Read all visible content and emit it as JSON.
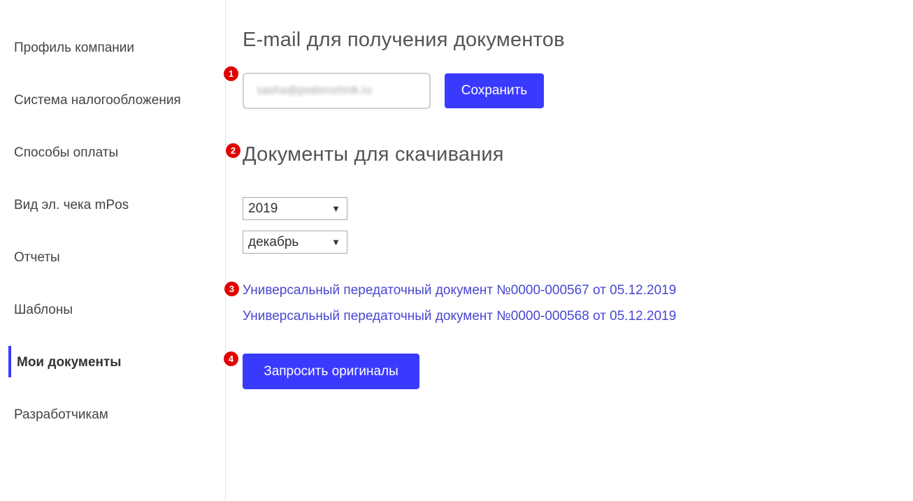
{
  "sidebar": {
    "items": [
      {
        "label": "Профиль компании"
      },
      {
        "label": "Система налогообложения"
      },
      {
        "label": "Способы оплаты"
      },
      {
        "label": "Вид эл. чека mPos"
      },
      {
        "label": "Отчеты"
      },
      {
        "label": "Шаблоны"
      },
      {
        "label": "Мои документы",
        "active": true
      },
      {
        "label": "Разработчикам"
      }
    ],
    "accent_color": "#3e3aff"
  },
  "email_section": {
    "title": "E-mail для получения документов",
    "email_value": "sasha@podorozhnik.ru",
    "save_label": "Сохранить"
  },
  "documents_section": {
    "title": "Документы для скачивания",
    "year_value": "2019",
    "month_value": "декабрь",
    "documents": [
      {
        "label": "Универсальный передаточный документ №0000-000567 от 05.12.2019"
      },
      {
        "label": "Универсальный передаточный документ №0000-000568 от 05.12.2019"
      }
    ],
    "request_label": "Запросить оригиналы"
  },
  "markers": [
    "1",
    "2",
    "3",
    "4"
  ],
  "colors": {
    "button": "#3a3aff",
    "link": "#4747d1",
    "marker": "#e00000"
  }
}
